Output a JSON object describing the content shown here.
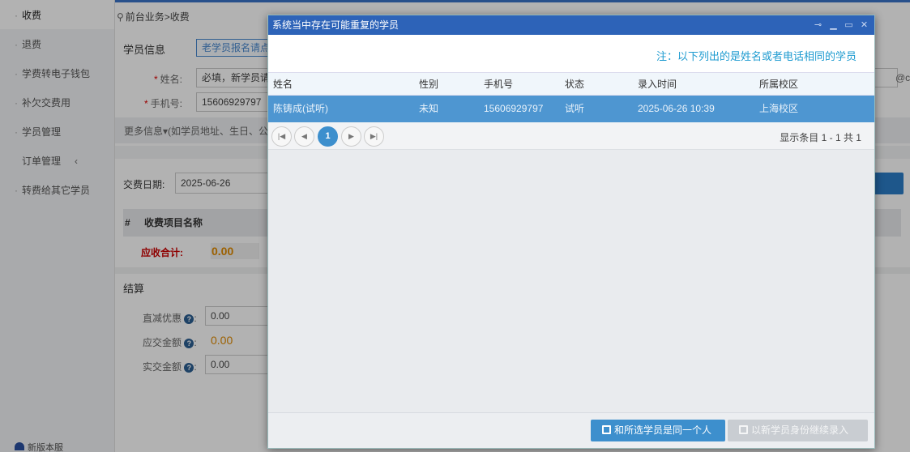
{
  "sidebar": {
    "items": [
      {
        "label": "收费",
        "active": true
      },
      {
        "label": "退费"
      },
      {
        "label": "学费转电子钱包"
      },
      {
        "label": "补欠交费用"
      },
      {
        "label": "学员管理"
      },
      {
        "label": "订单管理"
      },
      {
        "label": "转费给其它学员"
      }
    ],
    "footer": "新版本服"
  },
  "background": {
    "breadcrumb": "前台业务>收费",
    "student_info_title": "学员信息",
    "old_student_btn": "老学员报名请点",
    "name_label": "姓名:",
    "name_value": "必填，新学员请",
    "phone_label": "手机号:",
    "phone_value": "15606929797",
    "more_info": "更多信息▾(如学员地址、生日、公",
    "email_suffix": "@c",
    "pay_date_label": "交费日期:",
    "pay_date_value": "2025-06-26",
    "col_index": "#",
    "col_item_name": "收费项目名称",
    "total_label": "应收合计:",
    "total_value": "0.00",
    "settlement_title": "结算",
    "discount_label": "直减优惠",
    "discount_value": "0.00",
    "due_label": "应交金额",
    "due_value": "0.00",
    "paid_label": "实交金额",
    "paid_value": "0.00"
  },
  "dialog": {
    "title": "系统当中存在可能重复的学员",
    "note": "注：以下列出的是姓名或者电话相同的学员",
    "columns": [
      "姓名",
      "性别",
      "手机号",
      "状态",
      "录入时间",
      "所属校区"
    ],
    "rows": [
      {
        "name": "陈铸成(试听)",
        "gender": "未知",
        "phone": "15606929797",
        "status": "试听",
        "time": "2025-06-26 10:39",
        "campus": "上海校区",
        "selected": true
      }
    ],
    "pager": {
      "current_page": "1",
      "info": "显示条目 1 - 1 共 1"
    },
    "buttons": {
      "same_person": "和所选学员是同一个人",
      "new_student": "以新学员身份继续录入"
    }
  },
  "colors": {
    "dialog_header": "#2d63b8",
    "selected_row": "#4e96d1",
    "note_text": "#1e9bd0",
    "primary_button": "#3d8fcd",
    "total_value": "#e08a00"
  }
}
